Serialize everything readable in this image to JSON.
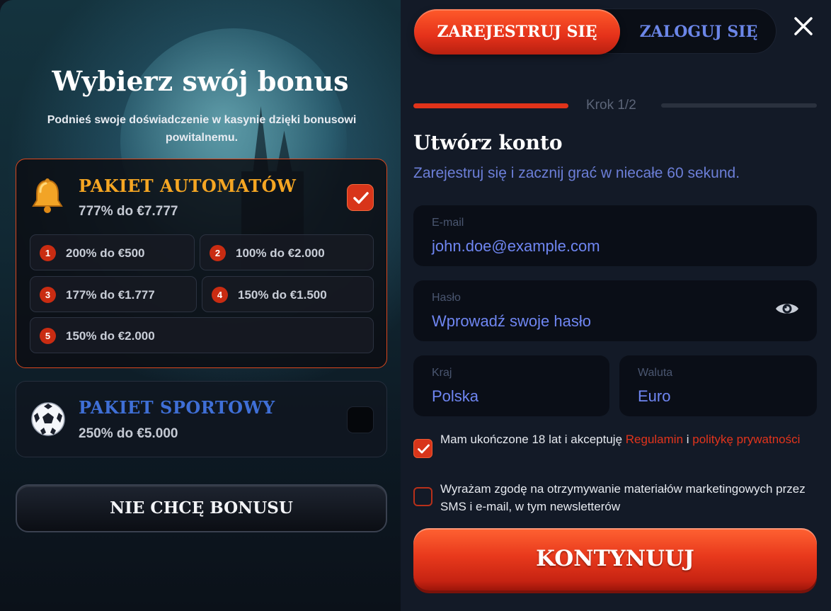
{
  "bonus_panel": {
    "title": "Wybierz swój bonus",
    "subtitle": "Podnieś swoje doświadczenie w kasynie dzięki bonusowi powitalnemu.",
    "packages": [
      {
        "icon": "bell-icon",
        "title": "PAKIET AUTOMATÓW",
        "amount": "777% do €7.777",
        "selected": true,
        "tiers": [
          {
            "num": "1",
            "text": "200% do €500"
          },
          {
            "num": "2",
            "text": "100% do €2.000"
          },
          {
            "num": "3",
            "text": "177% do €1.777"
          },
          {
            "num": "4",
            "text": "150% do €1.500"
          },
          {
            "num": "5",
            "text": "150% do €2.000"
          }
        ]
      },
      {
        "icon": "soccer-ball-icon",
        "title": "PAKIET SPORTOWY",
        "amount": "250% do €5.000",
        "selected": false
      }
    ],
    "no_bonus_label": "NIE CHCĘ BONUSU"
  },
  "auth": {
    "tabs": [
      {
        "label": "ZAREJESTRUJ SIĘ",
        "active": true
      },
      {
        "label": "ZALOGUJ SIĘ",
        "active": false
      }
    ],
    "step_label": "Krok 1/2",
    "step_progress": 0.5,
    "title": "Utwórz konto",
    "subtitle": "Zarejestruj się i zacznij grać w niecałe 60 sekund.",
    "fields": {
      "email": {
        "label": "E-mail",
        "value": "john.doe@example.com"
      },
      "password": {
        "label": "Hasło",
        "placeholder": "Wprowadź swoje hasło"
      },
      "country": {
        "label": "Kraj",
        "value": "Polska"
      },
      "currency": {
        "label": "Waluta",
        "value": "Euro"
      }
    },
    "consents": {
      "age": {
        "checked": true,
        "text_before": "Mam ukończone 18 lat i akceptuję ",
        "link1": "Regulamin",
        "text_mid": " i ",
        "link2": "politykę prywatności"
      },
      "marketing": {
        "checked": false,
        "text": "Wyrażam zgodę na otrzymywanie materiałów marketingowych przez SMS i e-mail, w tym newsletterów"
      }
    },
    "submit_label": "KONTYNUUJ"
  },
  "colors": {
    "accent": "#e0331a",
    "gold": "#f5a623",
    "blue": "#3f6fd6",
    "link": "#e2341c"
  }
}
